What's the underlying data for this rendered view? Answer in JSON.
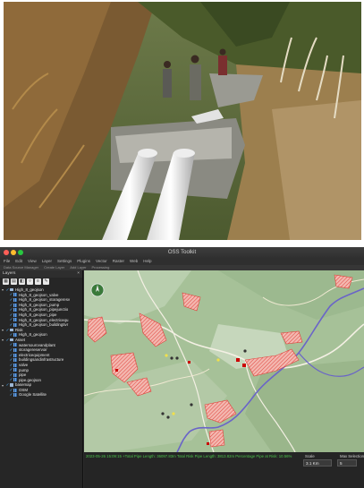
{
  "window": {
    "title": "OSS Toolkit"
  },
  "menu": {
    "items": [
      "File",
      "Edit",
      "View",
      "Layer",
      "Settings",
      "Plugins",
      "Vector",
      "Raster",
      "Web",
      "Help"
    ]
  },
  "toolbar2": {
    "items": [
      "Data Source Manager",
      "Create Layer",
      "Add Layer",
      "Processing"
    ]
  },
  "layers_panel": {
    "title": "Layers",
    "close": "×",
    "groups": [
      {
        "name": "High_8_geojson",
        "children": [
          "High_8_geojson_valve",
          "High_8_geojson_storageresv",
          "High_8_geojson_pump",
          "High_8_geojson_pipejunctio",
          "High_8_geojson_pipe",
          "High_8_geojson_electricequ",
          "High_8_geojson_buildingtivr"
        ]
      },
      {
        "name": "Risk",
        "children": [
          "High_8_geojson"
        ]
      },
      {
        "name": "Asset",
        "children": [
          "watersourceandplant",
          "storagereservoir",
          "electricequipment",
          "buildingsandinfrastructure",
          "valve",
          "pump",
          "pipe",
          "pipe.geojson"
        ]
      },
      {
        "name": "basemap",
        "children": [
          "OSM",
          "Google Satellite"
        ]
      }
    ]
  },
  "status": {
    "text": "2023-05-26 15:09:15 +Total Pipe Length: 36097.83m Total Risk Pipe Length: 3813.82m Percentage Pipe at Risk: 10.56%",
    "scale_label": "Scale",
    "scale_value": "3.1 Km",
    "max_selection_label": "Max Selection",
    "max_selection_value": "5"
  },
  "colors": {
    "status_green": "#4cc34c",
    "risk_red": "#e0403a",
    "river_purple": "#6a64c8"
  }
}
